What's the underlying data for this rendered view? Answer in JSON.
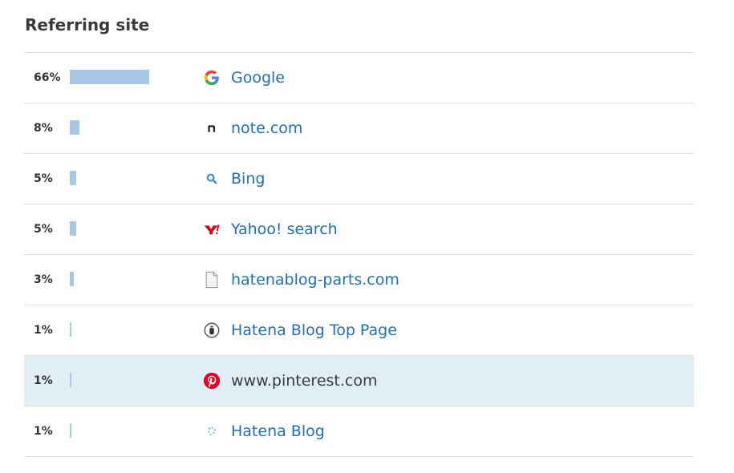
{
  "section": {
    "title": "Referring site"
  },
  "rows": [
    {
      "percent": "66%",
      "share": 0.66,
      "site": "Google",
      "icon": "google-icon",
      "linked": true
    },
    {
      "percent": "8%",
      "share": 0.08,
      "site": "note.com",
      "icon": "note-icon",
      "linked": true
    },
    {
      "percent": "5%",
      "share": 0.05,
      "site": "Bing",
      "icon": "bing-search-icon",
      "linked": true
    },
    {
      "percent": "5%",
      "share": 0.05,
      "site": "Yahoo! search",
      "icon": "yahoo-icon",
      "linked": true
    },
    {
      "percent": "3%",
      "share": 0.03,
      "site": "hatenablog-parts.com",
      "icon": "document-icon",
      "linked": true
    },
    {
      "percent": "1%",
      "share": 0.01,
      "site": "Hatena Blog Top Page",
      "icon": "hatena-blog-top-icon",
      "linked": true
    },
    {
      "percent": "1%",
      "share": 0.01,
      "site": "www.pinterest.com",
      "icon": "pinterest-icon",
      "linked": false,
      "highlighted": true
    },
    {
      "percent": "1%",
      "share": 0.01,
      "site": "Hatena Blog",
      "icon": "hatena-blog-icon",
      "linked": true
    }
  ],
  "colors": {
    "bar": "#a8c8e8",
    "link": "#1f6fbf",
    "highlight_row": "#e1eef6",
    "divider": "#dddddd"
  }
}
